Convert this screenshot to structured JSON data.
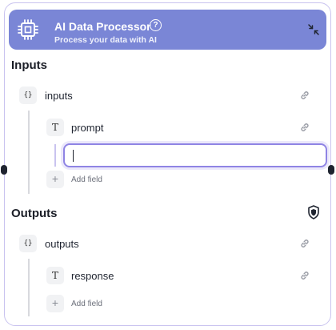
{
  "header": {
    "title": "AI Data Processor",
    "subtitle": "Process your data with AI",
    "help_glyph": "?",
    "icon": "cpu-chip-icon",
    "collapse_icon": "collapse-arrows-icon",
    "color": "#7a86d6"
  },
  "inputs": {
    "title": "Inputs",
    "group": {
      "badge": "{}",
      "label": "inputs",
      "fields": [
        {
          "badge": "T",
          "label": "prompt",
          "value": ""
        }
      ],
      "add_label": "Add field"
    }
  },
  "outputs": {
    "title": "Outputs",
    "icon": "shield-icon",
    "group": {
      "badge": "{}",
      "label": "outputs",
      "fields": [
        {
          "badge": "T",
          "label": "response"
        }
      ],
      "add_label": "Add field"
    }
  },
  "icons": {
    "link": "link-icon",
    "add": "+"
  },
  "colors": {
    "accent": "#8f84e4",
    "border": "#c9c3ef"
  }
}
